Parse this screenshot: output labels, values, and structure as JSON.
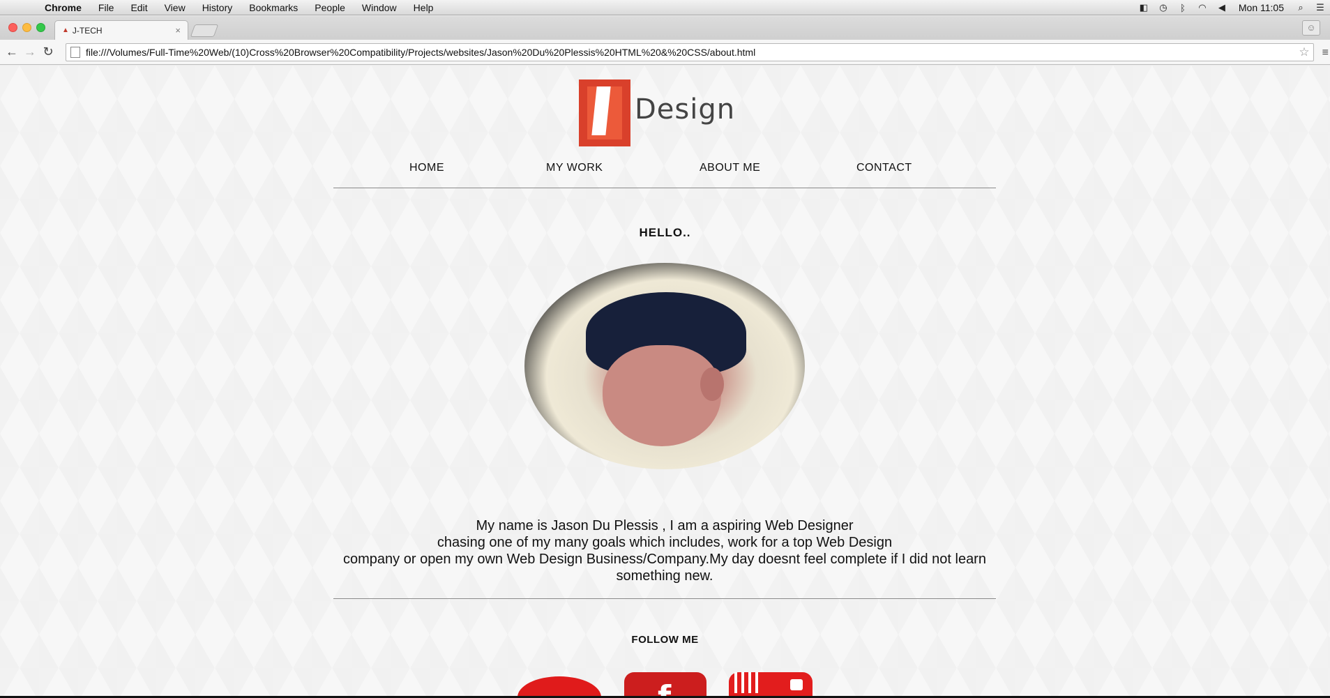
{
  "menubar": {
    "app_name": "Chrome",
    "items": [
      "File",
      "Edit",
      "View",
      "History",
      "Bookmarks",
      "People",
      "Window",
      "Help"
    ],
    "clock": "Mon 11:05"
  },
  "browser": {
    "tab_title": "J-TECH",
    "url": "file:///Volumes/Full-Time%20Web/(10)Cross%20Browser%20Compatibility/Projects/websites/Jason%20Du%20Plessis%20HTML%20&%20CSS/about.html"
  },
  "site": {
    "logo_text": "Design",
    "nav": [
      "HOME",
      "MY WORK",
      "ABOUT ME",
      "CONTACT"
    ],
    "heading": "HELLO..",
    "bio_lines": [
      "My name is Jason Du Plessis , I am a aspiring Web Designer",
      "chasing one of my many goals which includes, work for a top Web Design",
      "company or open my own Web Design Business/Company.My day doesnt feel complete if I did not learn",
      "something new."
    ],
    "follow": "FOLLOW ME",
    "social_letter": "f"
  }
}
